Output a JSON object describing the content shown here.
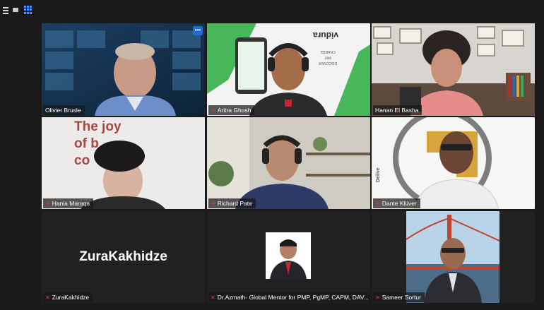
{
  "participants": [
    {
      "name": "Olivier Brusle",
      "muted": false
    },
    {
      "name": "Aritra Ghosh",
      "muted": true
    },
    {
      "name": "Hanan El Basha",
      "muted": false
    },
    {
      "name": "Hania Maraqa",
      "muted": true
    },
    {
      "name": "Richard Pate",
      "muted": true
    },
    {
      "name": "Dante Klüver",
      "muted": true
    },
    {
      "name": "ZuraKakhidze",
      "muted": true,
      "video_off": true,
      "display_name": "ZuraKakhidze"
    },
    {
      "name": "Dr.Azmath- Global Mentor for PMP, PgMP, CAPM, DAV...",
      "muted": true
    },
    {
      "name": "Sameer Sortur",
      "muted": true
    }
  ],
  "backdrop_text": {
    "hania_wall": [
      "The joy",
      "of b",
      "co"
    ],
    "aritra_logo": "vidura",
    "aritra_banner": [
      "DISCOVER",
      "PAY",
      "CHARGE"
    ],
    "dante_logo_text": "Delive"
  },
  "colors": {
    "active_speaker": "#e8e93a",
    "muted_icon": "#e23b3b",
    "accent": "#1e6bd6"
  },
  "icons": [
    "menu-icon",
    "grid-view-icon",
    "more-options-icon",
    "muted-mic-icon"
  ]
}
